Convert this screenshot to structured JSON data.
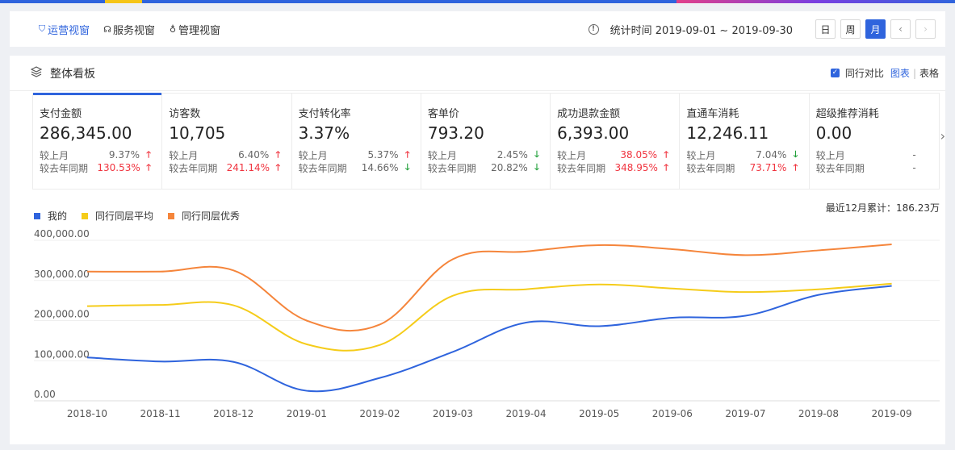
{
  "nav": {
    "tabs": [
      {
        "label": "运营视窗",
        "icon": "shield-icon",
        "active": true
      },
      {
        "label": "服务视窗",
        "icon": "headset-icon",
        "active": false
      },
      {
        "label": "管理视窗",
        "icon": "person-icon",
        "active": false
      }
    ],
    "stat_time": "统计时间 2019-09-01 ~ 2019-09-30",
    "periods": [
      "日",
      "周",
      "月"
    ],
    "active_period": "月"
  },
  "panel": {
    "title": "整体看板",
    "compare_label": "同行对比",
    "compare_checked": true,
    "view_chart": "图表",
    "view_table": "表格",
    "cumulative": "最近12月累计：186.23万"
  },
  "metrics": [
    {
      "title": "支付金额",
      "value": "286,345.00",
      "rows": [
        {
          "label": "较上月",
          "val": "9.37%",
          "dir": "up",
          "red": false
        },
        {
          "label": "较去年同期",
          "val": "130.53%",
          "dir": "up",
          "red": true
        }
      ]
    },
    {
      "title": "访客数",
      "value": "10,705",
      "rows": [
        {
          "label": "较上月",
          "val": "6.40%",
          "dir": "up",
          "red": false
        },
        {
          "label": "较去年同期",
          "val": "241.14%",
          "dir": "up",
          "red": true
        }
      ]
    },
    {
      "title": "支付转化率",
      "value": "3.37%",
      "rows": [
        {
          "label": "较上月",
          "val": "5.37%",
          "dir": "up",
          "red": false
        },
        {
          "label": "较去年同期",
          "val": "14.66%",
          "dir": "down",
          "red": false
        }
      ]
    },
    {
      "title": "客单价",
      "value": "793.20",
      "rows": [
        {
          "label": "较上月",
          "val": "2.45%",
          "dir": "down",
          "red": false
        },
        {
          "label": "较去年同期",
          "val": "20.82%",
          "dir": "down",
          "red": false
        }
      ]
    },
    {
      "title": "成功退款金额",
      "value": "6,393.00",
      "rows": [
        {
          "label": "较上月",
          "val": "38.05%",
          "dir": "up",
          "red": true
        },
        {
          "label": "较去年同期",
          "val": "348.95%",
          "dir": "up",
          "red": true
        }
      ]
    },
    {
      "title": "直通车消耗",
      "value": "12,246.11",
      "rows": [
        {
          "label": "较上月",
          "val": "7.04%",
          "dir": "down",
          "red": false
        },
        {
          "label": "较去年同期",
          "val": "73.71%",
          "dir": "up",
          "red": true
        }
      ]
    },
    {
      "title": "超级推荐消耗",
      "value": "0.00",
      "rows": [
        {
          "label": "较上月",
          "val": "-",
          "dir": "none",
          "red": false
        },
        {
          "label": "较去年同期",
          "val": "-",
          "dir": "none",
          "red": false
        }
      ]
    }
  ],
  "colors": {
    "accent": "#2f64dd",
    "up": "#f0343f",
    "down": "#21a03a"
  },
  "chart_data": {
    "type": "line",
    "categories": [
      "2018-10",
      "2018-11",
      "2018-12",
      "2019-01",
      "2019-02",
      "2019-03",
      "2019-04",
      "2019-05",
      "2019-06",
      "2019-07",
      "2019-08",
      "2019-09"
    ],
    "ylim": [
      0,
      400000
    ],
    "yticks": [
      "0.00",
      "100,000.00",
      "200,000.00",
      "300,000.00",
      "400,000.00"
    ],
    "grid": true,
    "legend_position": "top-left",
    "series": [
      {
        "name": "我的",
        "color": "#2f64dd",
        "values": [
          108000,
          98000,
          97000,
          25000,
          57000,
          122000,
          195000,
          186000,
          207000,
          212000,
          264000,
          286345
        ]
      },
      {
        "name": "同行同层平均",
        "color": "#f5cc1a",
        "values": [
          236000,
          239000,
          238000,
          141000,
          139000,
          262000,
          278000,
          290000,
          280000,
          271000,
          278000,
          292000
        ]
      },
      {
        "name": "同行同层优秀",
        "color": "#f5853b",
        "values": [
          322000,
          322000,
          325000,
          200000,
          190000,
          353000,
          372000,
          388000,
          378000,
          363000,
          375000,
          390000
        ]
      }
    ]
  }
}
